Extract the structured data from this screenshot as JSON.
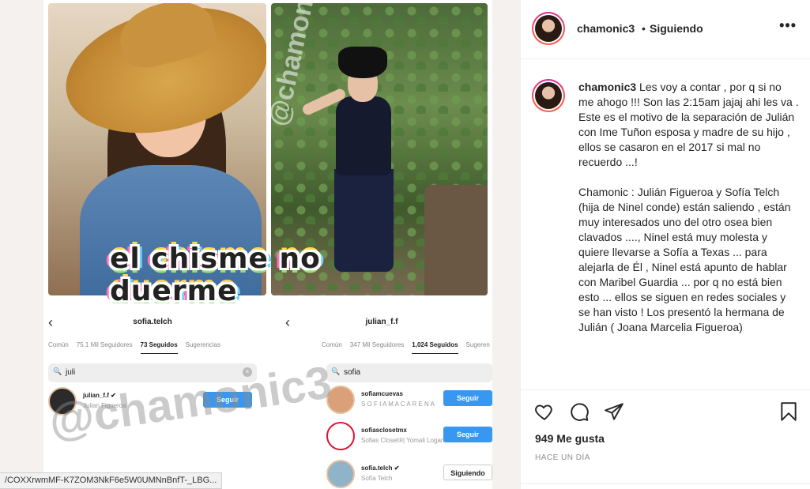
{
  "post": {
    "username": "chamonic3",
    "follow_status": "Siguiendo",
    "separator": "•",
    "more_label": "•••",
    "caption_user": "chamonic3",
    "caption_text": " Les voy a contar , por q si no me ahogo !!! Son las 2:15am jajaj ahi les va .\nEste es el motivo de la separación de Julián con Ime Tuñon esposa y madre de su hijo , ellos se casaron en el 2017 si mal no recuerdo ...!\n\nChamonic : Julián Figueroa y Sofía Telch\n(hija de Ninel conde) están saliendo , están muy interesados uno del otro osea bien clavados ...., Ninel está muy molesta y quiere llevarse a Sofía a Texas ... para alejarla de Él , Ninel está apunto de hablar con Maribel Guardia ... por q no está bien esto ... ellos se siguen en redes sociales y se han visto ! Los presentó la hermana de Julián ( Joana Marcelia Figueroa)",
    "likes": "949 Me gusta",
    "time_ago": "HACE UN DÍA"
  },
  "media": {
    "banner_text": "el chisme no duerme",
    "watermark": "@chamonic3",
    "watermark_mid": "@chamonic3",
    "panel_left": {
      "back": "‹",
      "title": "sofia.telch",
      "tabs": [
        "Común",
        "75.1 Mil Seguidores",
        "73 Seguidos",
        "Sugerencias"
      ],
      "active_tab": 2,
      "search": "juli",
      "clear": "×",
      "rows": [
        {
          "user": "julian_f.f ✔",
          "sub": "Julian Figueroa",
          "button": "Seguir"
        }
      ]
    },
    "panel_right": {
      "back": "‹",
      "title": "julian_f.f",
      "tabs": [
        "Común",
        "347 Mil Seguidores",
        "1,024 Seguidos",
        "Sugeren"
      ],
      "active_tab": 2,
      "search": "sofia",
      "rows": [
        {
          "user": "sofiamcuevas",
          "sub": "S O F I A  M A C A R E N A",
          "button": "Seguir"
        },
        {
          "user": "sofiasclosetmx",
          "sub": "Sofias Closet®| Yomali Logan",
          "button": "Seguir"
        },
        {
          "user": "sofia.telch ✔",
          "sub": "Sofía Telch",
          "button": "Siguiendo"
        }
      ]
    }
  },
  "status_bar": {
    "url": "/COXXrwmMF-K7ZOM3NkF6e5W0UMNnBnfT-_LBG..."
  },
  "icons": [
    "heart-icon",
    "comment-icon",
    "share-icon",
    "bookmark-icon",
    "more-icon"
  ]
}
